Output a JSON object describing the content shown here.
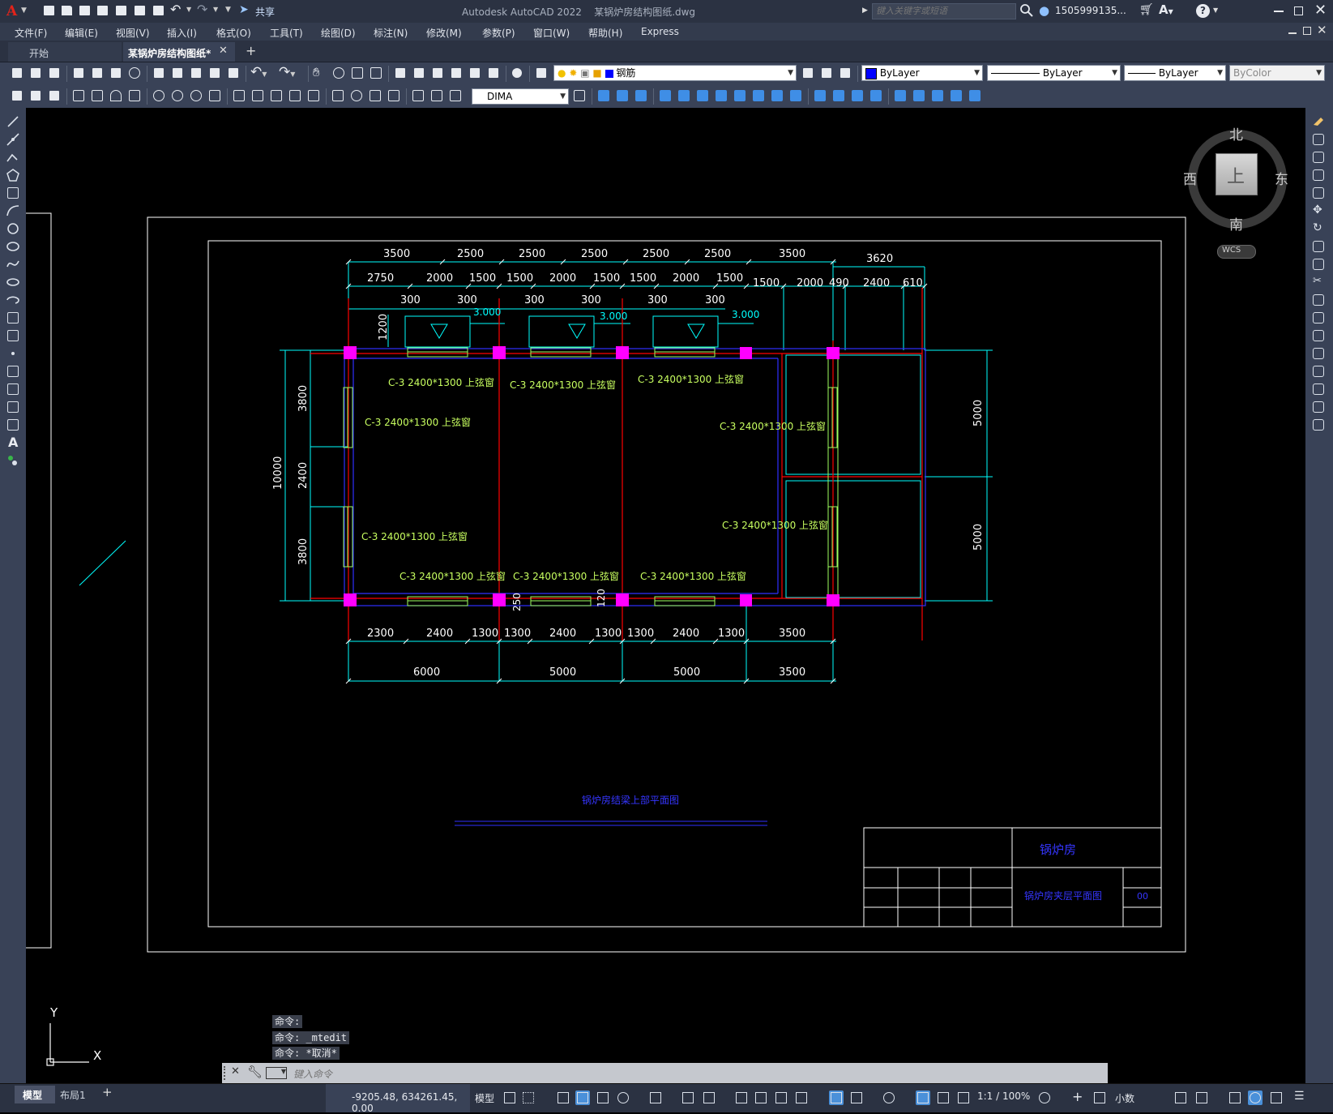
{
  "title": {
    "app": "Autodesk AutoCAD 2022",
    "file": "某锅炉房结构图纸.dwg",
    "share": "共享",
    "search_placeholder": "键入关键字或短语",
    "user": "1505999135..."
  },
  "menu": [
    "文件(F)",
    "编辑(E)",
    "视图(V)",
    "插入(I)",
    "格式(O)",
    "工具(T)",
    "绘图(D)",
    "标注(N)",
    "修改(M)",
    "参数(P)",
    "窗口(W)",
    "帮助(H)",
    "Express"
  ],
  "tabs": {
    "start": "开始",
    "doc": "某锅炉房结构图纸*",
    "add": "+"
  },
  "toolbar": {
    "layer": "钢筋",
    "color": "ByLayer",
    "linetype": "ByLayer",
    "lineweight": "ByLayer",
    "plotstyle": "ByColor",
    "dimstyle": "DIMA"
  },
  "viewcube": {
    "north": "北",
    "south": "南",
    "east": "东",
    "west": "西",
    "top": "上",
    "wcs": "WCS"
  },
  "drawing": {
    "top_dims_row1": [
      "3500",
      "2500",
      "2500",
      "2500",
      "2500",
      "2500",
      "3500",
      "3620"
    ],
    "top_dims_row2": [
      "2750",
      "2000",
      "1500",
      "1500",
      "2000",
      "1500",
      "1500",
      "2000",
      "1500",
      "1500",
      "2000",
      "490",
      "2400",
      "610"
    ],
    "top_dims_row3": [
      "300",
      "300",
      "300",
      "300",
      "300",
      "300"
    ],
    "elev": [
      "3.000",
      "3.000",
      "3.000"
    ],
    "dim_1200": "1200",
    "win_top": [
      "C-3 2400*1300 上弦窗",
      "C-3 2400*1300 上弦窗",
      "C-3 2400*1300 上弦窗"
    ],
    "win_left": [
      "C-3 2400*1300 上弦窗",
      "C-3 2400*1300 上弦窗"
    ],
    "win_right": [
      "C-3 2400*1300 上弦窗",
      "C-3 2400*1300 上弦窗"
    ],
    "win_bottom": [
      "C-3 2400*1300 上弦窗",
      "C-3 2400*1300 上弦窗",
      "C-3 2400*1300 上弦窗"
    ],
    "left_dims": [
      "3800",
      "2400",
      "3800"
    ],
    "left_total": "10000",
    "right_dims": [
      "5000",
      "5000"
    ],
    "small_dims": [
      "250",
      "120"
    ],
    "bottom_dims_row1": [
      "2300",
      "2400",
      "1300",
      "1300",
      "2400",
      "1300",
      "1300",
      "2400",
      "1300",
      "3500"
    ],
    "bottom_dims_row2": [
      "6000",
      "5000",
      "5000",
      "3500"
    ],
    "plan_title": "锅炉房结梁上部平面图",
    "titleblock_name": "锅炉房",
    "titleblock_drawing": "锅炉房夹层平面图",
    "titleblock_no": "00"
  },
  "ucs": {
    "x": "X",
    "y": "Y"
  },
  "command": {
    "history": [
      "命令:",
      "命令: _mtedit",
      "命令: *取消*"
    ],
    "placeholder": "键入命令"
  },
  "status": {
    "model_tab": "模型",
    "layout_tab": "布局1",
    "coords": "-9205.48, 634261.45, 0.00",
    "model": "模型",
    "scale": "1:1 / 100%",
    "units": "小数"
  }
}
